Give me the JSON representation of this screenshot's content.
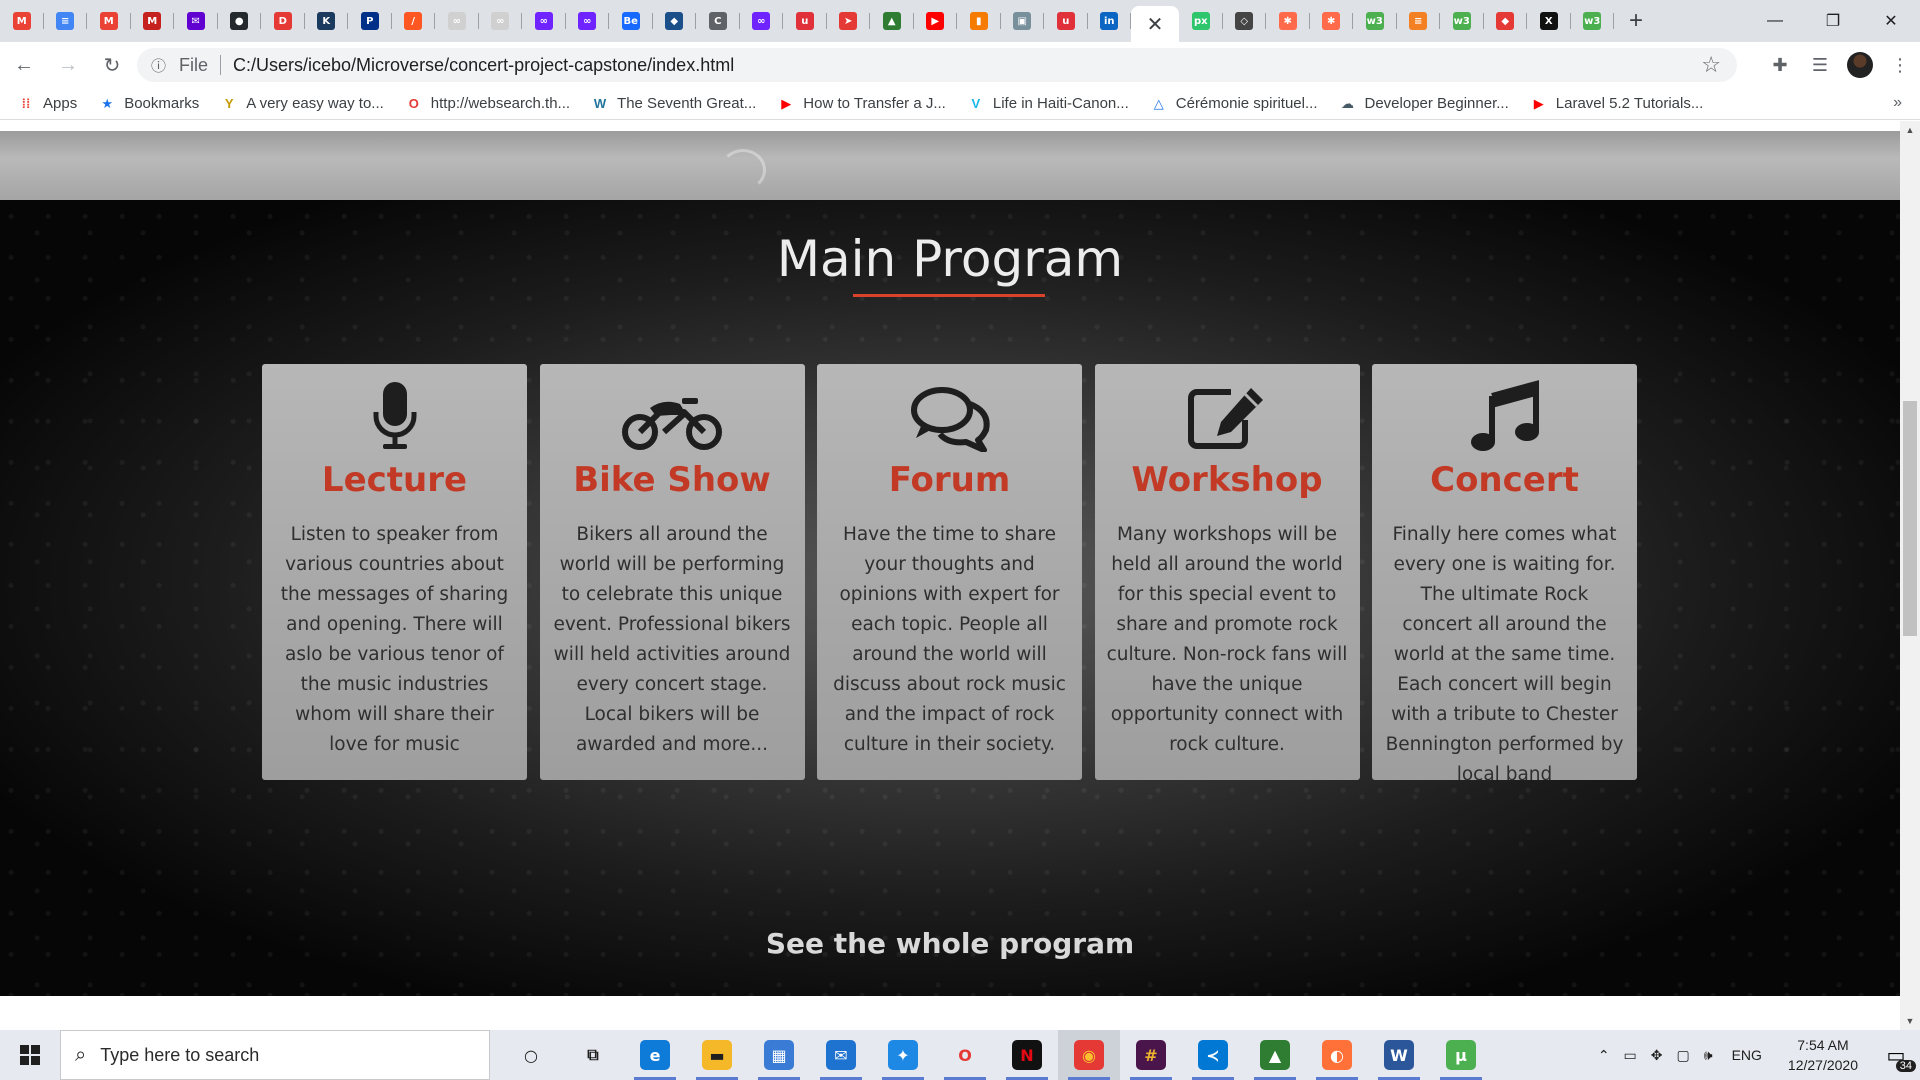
{
  "browser": {
    "tabs": [
      {
        "icon": "gmail-icon",
        "glyph": "M",
        "color": "#ea4335"
      },
      {
        "icon": "google-docs-icon",
        "glyph": "≡",
        "color": "#4285f4"
      },
      {
        "icon": "gmail-icon",
        "glyph": "M",
        "color": "#ea4335"
      },
      {
        "icon": "gmail-icon",
        "glyph": "M",
        "color": "#c5221f"
      },
      {
        "icon": "yahoo-mail-icon",
        "glyph": "✉",
        "color": "#6001d2"
      },
      {
        "icon": "github-icon",
        "glyph": "●",
        "color": "#24292e"
      },
      {
        "icon": "dynamic-icon",
        "glyph": "D",
        "color": "#e53935"
      },
      {
        "icon": "kanban-icon",
        "glyph": "K",
        "color": "#1a3b5d"
      },
      {
        "icon": "paypal-icon",
        "glyph": "P",
        "color": "#003087"
      },
      {
        "icon": "sketch-icon",
        "glyph": "/",
        "color": "#ff5722"
      },
      {
        "icon": "loading-icon",
        "glyph": "∞",
        "color": "#d0d0d0"
      },
      {
        "icon": "loading-icon",
        "glyph": "∞",
        "color": "#d0d0d0"
      },
      {
        "icon": "microverse-icon",
        "glyph": "∞",
        "color": "#6f23ff"
      },
      {
        "icon": "microverse-icon",
        "glyph": "∞",
        "color": "#6f23ff"
      },
      {
        "icon": "behance-icon",
        "glyph": "Be",
        "color": "#1769ff"
      },
      {
        "icon": "chat-icon",
        "glyph": "◆",
        "color": "#1b4f8a"
      },
      {
        "icon": "reload-c-icon",
        "glyph": "C",
        "color": "#5f6368"
      },
      {
        "icon": "microverse-icon",
        "glyph": "∞",
        "color": "#6f23ff"
      },
      {
        "icon": "udemy-icon",
        "glyph": "u",
        "color": "#e0313b"
      },
      {
        "icon": "paper-plane-icon",
        "glyph": "➤",
        "color": "#e53935"
      },
      {
        "icon": "chart-icon",
        "glyph": "▲",
        "color": "#2e7d32"
      },
      {
        "icon": "youtube-icon",
        "glyph": "▶",
        "color": "#ff0000"
      },
      {
        "icon": "bookmark-icon",
        "glyph": "▮",
        "color": "#f57c00"
      },
      {
        "icon": "image-icon",
        "glyph": "▣",
        "color": "#78909c"
      },
      {
        "icon": "udemy-icon",
        "glyph": "u",
        "color": "#e0313b"
      },
      {
        "icon": "linkedin-icon",
        "glyph": "in",
        "color": "#0a66c2"
      },
      {
        "icon": "pixabay-icon",
        "glyph": "px",
        "color": "#2ec66d"
      },
      {
        "icon": "git-icon",
        "glyph": "◇",
        "color": "#444"
      },
      {
        "icon": "asterisk-icon",
        "glyph": "✱",
        "color": "#ff6b4a"
      },
      {
        "icon": "asterisk-icon",
        "glyph": "✱",
        "color": "#ff6b4a"
      },
      {
        "icon": "w3schools-icon",
        "glyph": "w3",
        "color": "#4caf50"
      },
      {
        "icon": "stackoverflow-icon",
        "glyph": "≡",
        "color": "#f48024"
      },
      {
        "icon": "w3schools-icon",
        "glyph": "w3",
        "color": "#4caf50"
      },
      {
        "icon": "fire-icon",
        "glyph": "◆",
        "color": "#e53935"
      },
      {
        "icon": "x-icon",
        "glyph": "X",
        "color": "#111111"
      },
      {
        "icon": "w3schools-icon",
        "glyph": "w3",
        "color": "#4caf50"
      }
    ],
    "active_tab_close": "✕",
    "new_tab": "+",
    "window": {
      "minimize": "—",
      "maximize": "❐",
      "close": "✕"
    },
    "nav": {
      "back": "←",
      "forward": "→",
      "reload": "↻"
    },
    "address": {
      "info": "ⓘ",
      "scheme_label": "File",
      "url": "C:/Users/icebo/Microverse/concert-project-capstone/index.html",
      "star": "☆"
    },
    "toolbar_icons": {
      "extensions": "✚",
      "reading_list": "☰"
    },
    "bookmarks": [
      {
        "label": "Apps",
        "icon": "apps-grid-icon",
        "glyph": "⁞⁞",
        "color": "#ea4335"
      },
      {
        "label": "Bookmarks",
        "icon": "star-icon",
        "glyph": "★",
        "color": "#1a73e8"
      },
      {
        "label": "A very easy way to...",
        "icon": "y-icon",
        "glyph": "Y",
        "color": "#c49a00"
      },
      {
        "label": "http://websearch.th...",
        "icon": "opera-icon",
        "glyph": "O",
        "color": "#e53935"
      },
      {
        "label": "The Seventh Great...",
        "icon": "wordpress-icon",
        "glyph": "W",
        "color": "#21759b"
      },
      {
        "label": "How to Transfer a J...",
        "icon": "youtube-icon",
        "glyph": "▶",
        "color": "#ff0000"
      },
      {
        "label": "Life in Haiti-Canon...",
        "icon": "vimeo-icon",
        "glyph": "V",
        "color": "#1ab7ea"
      },
      {
        "label": "Cérémonie spirituel...",
        "icon": "triangle-icon",
        "glyph": "△",
        "color": "#1a73e8"
      },
      {
        "label": "Developer Beginner...",
        "icon": "cloud-icon",
        "glyph": "☁",
        "color": "#455a64"
      },
      {
        "label": "Laravel 5.2 Tutorials...",
        "icon": "youtube-icon",
        "glyph": "▶",
        "color": "#ff0000"
      }
    ],
    "bookmarks_more": "»"
  },
  "page": {
    "section_title": "Main Program",
    "accent_color": "#d9432c",
    "cards": [
      {
        "icon": "microphone-icon",
        "title": "Lecture",
        "text": "Listen to speaker from various countries about the messages of sharing and opening. There will aslo be various tenor of the music industries whom will share their love for music"
      },
      {
        "icon": "motorcycle-icon",
        "title": "Bike Show",
        "text": "Bikers all around the world will be performing to celebrate this unique event. Professional bikers will held activities around every concert stage. Local bikers will be awarded and more..."
      },
      {
        "icon": "chat-bubbles-icon",
        "title": "Forum",
        "text": "Have the time to share your thoughts and opinions with expert for each topic. People all around the world will discuss about rock music and the impact of rock culture in their society."
      },
      {
        "icon": "edit-icon",
        "title": "Workshop",
        "text": "Many workshops will be held all around the world for this special event to share and promote rock culture. Non-rock fans will have the unique opportunity connect with rock culture."
      },
      {
        "icon": "music-note-icon",
        "title": "Concert",
        "text": "Finally here comes what every one is waiting for. The ultimate Rock concert all around the world at the same time. Each concert will begin with a tribute to Chester Bennington performed by local band"
      }
    ],
    "see_program_link": "See the whole program"
  },
  "taskbar": {
    "search_placeholder": "Type here to search",
    "apps": [
      {
        "name": "cortana-icon",
        "glyph": "○",
        "color": "transparent",
        "fg": "#1f1f1f"
      },
      {
        "name": "task-view-icon",
        "glyph": "⧉",
        "color": "transparent",
        "fg": "#1f1f1f"
      },
      {
        "name": "edge-icon",
        "glyph": "e",
        "color": "#0f7bd8",
        "fg": "#ffffff"
      },
      {
        "name": "file-explorer-icon",
        "glyph": "▬",
        "color": "#f5b829",
        "fg": "#1f1f1f"
      },
      {
        "name": "store-icon",
        "glyph": "▦",
        "color": "#3a7bd5",
        "fg": "#ffffff"
      },
      {
        "name": "mail-icon",
        "glyph": "✉",
        "color": "#1e73d1",
        "fg": "#ffffff"
      },
      {
        "name": "safari-compass-icon",
        "glyph": "✦",
        "color": "#1e88e5",
        "fg": "#ffffff"
      },
      {
        "name": "opera-icon",
        "glyph": "O",
        "color": "transparent",
        "fg": "#e53935"
      },
      {
        "name": "netflix-icon",
        "glyph": "N",
        "color": "#111111",
        "fg": "#e50914"
      },
      {
        "name": "chrome-icon",
        "glyph": "◉",
        "color": "#e53935",
        "fg": "#fbc02d"
      },
      {
        "name": "slack-icon",
        "glyph": "#",
        "color": "#4a154b",
        "fg": "#ecb22e"
      },
      {
        "name": "vscode-icon",
        "glyph": "≺",
        "color": "#0078d4",
        "fg": "#ffffff"
      },
      {
        "name": "photo-icon",
        "glyph": "▲",
        "color": "#2e7d32",
        "fg": "#ffffff"
      },
      {
        "name": "firefox-icon",
        "glyph": "◐",
        "color": "#ff7139",
        "fg": "#ffffff"
      },
      {
        "name": "word-icon",
        "glyph": "W",
        "color": "#2b579a",
        "fg": "#ffffff"
      },
      {
        "name": "utorrent-icon",
        "glyph": "µ",
        "color": "#4caf50",
        "fg": "#ffffff"
      }
    ],
    "active_app": "chrome-icon",
    "tray": {
      "chevron": "⌃",
      "language": "ENG",
      "time": "7:54 AM",
      "date": "12/27/2020",
      "notifications": "34"
    }
  }
}
